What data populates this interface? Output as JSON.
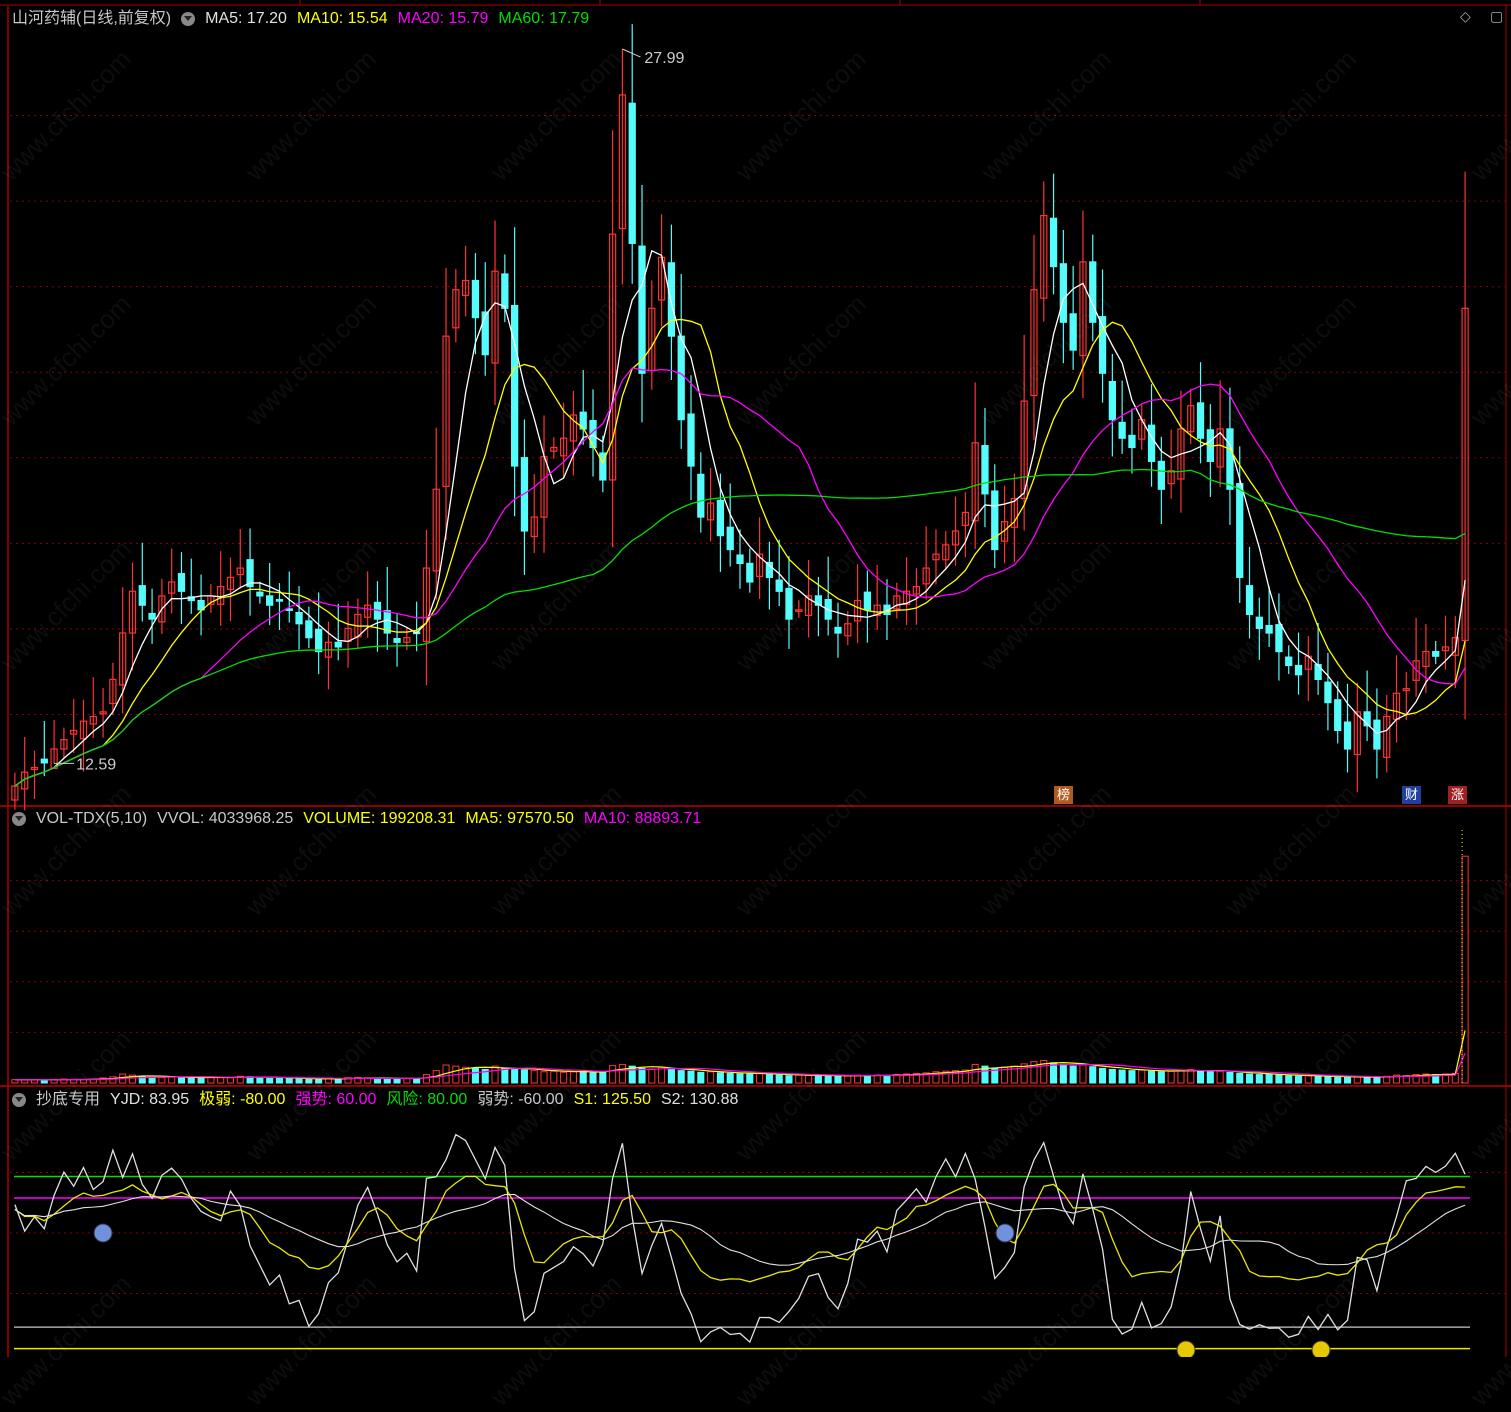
{
  "main": {
    "title": "山河药辅(日线,前复权)",
    "ma5_label": "MA5: 17.20",
    "ma10_label": "MA10: 15.54",
    "ma20_label": "MA20: 15.79",
    "ma60_label": "MA60: 17.79",
    "high_label": "27.99",
    "low_label": "12.59",
    "badge_bang": "榜",
    "badge_cai": "财",
    "badge_zhang": "涨"
  },
  "vol_panel": {
    "title": "VOL-TDX(5,10)",
    "vvol_label": "VVOL: 4033968.25",
    "volume_label": "VOLUME: 199208.31",
    "ma5_label": "MA5: 97570.50",
    "ma10_label": "MA10: 88893.71"
  },
  "ind_panel": {
    "title": "抄底专用",
    "yjd_label": "YJD: 83.95",
    "jiruo_label": "极弱: -80.00",
    "qiangshi_label": "强势: 60.00",
    "fengxian_label": "风险: 80.00",
    "ruoshi_label": "弱势: -60.00",
    "s1_label": "S1: 125.50",
    "s2_label": "S2: 130.88"
  },
  "watermark": "www.cfchi.com",
  "colors": {
    "up": "#ff3232",
    "down": "#54fcfc",
    "ma5": "#ffffff",
    "ma10": "#ffff00",
    "ma20": "#ff00ff",
    "ma60": "#00e000",
    "grid": "#8b0000",
    "ind_yellow": "#e8e800",
    "ind_white": "#e0e0e0",
    "ind_green": "#00e000",
    "ind_magenta": "#ff00ff"
  },
  "chart_data": {
    "type": "candlestick",
    "price_range": [
      11.8,
      28.4
    ],
    "closes": [
      12.1,
      12.4,
      12.5,
      12.6,
      12.9,
      13.1,
      13.3,
      13.5,
      13.6,
      13.7,
      14.4,
      15.4,
      16.3,
      16.0,
      15.7,
      16.2,
      16.5,
      16.3,
      16.1,
      15.9,
      16.2,
      16.4,
      16.6,
      16.8,
      16.4,
      16.2,
      16.0,
      16.1,
      15.9,
      15.6,
      15.3,
      15.0,
      15.2,
      15.1,
      15.5,
      15.8,
      16.0,
      15.7,
      15.4,
      15.2,
      15.3,
      15.4,
      16.8,
      18.5,
      21.8,
      22.8,
      23.0,
      22.2,
      21.4,
      23.2,
      22.4,
      19.0,
      17.6,
      17.9,
      19.2,
      19.4,
      19.6,
      20.1,
      19.8,
      19.4,
      18.7,
      24.0,
      27.0,
      23.8,
      21.0,
      22.4,
      23.5,
      21.8,
      20.0,
      19.0,
      17.9,
      18.2,
      17.5,
      17.2,
      16.9,
      16.5,
      17.1,
      16.6,
      16.3,
      15.7,
      15.9,
      16.2,
      16.0,
      15.7,
      15.4,
      15.6,
      16.1,
      15.9,
      16.0,
      15.8,
      16.2,
      16.3,
      16.4,
      16.8,
      17.1,
      17.3,
      17.6,
      18.0,
      19.5,
      18.4,
      17.2,
      17.8,
      18.3,
      20.4,
      22.8,
      24.4,
      23.3,
      22.1,
      21.5,
      23.4,
      22.1,
      21.0,
      20.0,
      19.6,
      19.4,
      20.0,
      19.1,
      18.5,
      18.9,
      19.8,
      20.3,
      19.6,
      19.1,
      19.8,
      18.5,
      16.6,
      15.8,
      15.5,
      15.4,
      15.0,
      14.7,
      14.5,
      14.9,
      14.4,
      13.9,
      13.3,
      12.9,
      13.7,
      13.4,
      12.9,
      13.6,
      14.1,
      14.2,
      14.8,
      15.0,
      14.9,
      15.1,
      15.3,
      22.4
    ],
    "volume_range": [
      0,
      4500000
    ],
    "volumes_k": [
      60,
      55,
      58,
      52,
      60,
      70,
      65,
      62,
      68,
      90,
      110,
      160,
      140,
      120,
      100,
      95,
      110,
      100,
      95,
      90,
      105,
      100,
      95,
      120,
      110,
      100,
      90,
      85,
      80,
      75,
      70,
      68,
      80,
      75,
      95,
      100,
      90,
      85,
      80,
      75,
      78,
      80,
      150,
      220,
      320,
      300,
      280,
      260,
      240,
      300,
      260,
      240,
      230,
      220,
      200,
      210,
      190,
      200,
      210,
      180,
      200,
      310,
      330,
      300,
      260,
      250,
      280,
      240,
      220,
      210,
      190,
      200,
      180,
      170,
      165,
      160,
      170,
      150,
      140,
      130,
      140,
      135,
      130,
      125,
      120,
      130,
      140,
      135,
      140,
      130,
      150,
      160,
      170,
      180,
      200,
      210,
      220,
      230,
      330,
      300,
      260,
      280,
      300,
      340,
      380,
      400,
      360,
      330,
      300,
      320,
      290,
      260,
      240,
      230,
      220,
      230,
      210,
      200,
      210,
      230,
      240,
      220,
      200,
      210,
      190,
      170,
      160,
      150,
      150,
      140,
      130,
      120,
      130,
      120,
      110,
      105,
      100,
      110,
      110,
      100,
      120,
      140,
      130,
      150,
      160,
      150,
      160,
      170,
      4034
    ],
    "indicator_range": [
      -85,
      140
    ],
    "levels": {
      "jiruo": -80,
      "ruoshi": -60,
      "qiangshi": 60,
      "fengxian": 80
    }
  }
}
